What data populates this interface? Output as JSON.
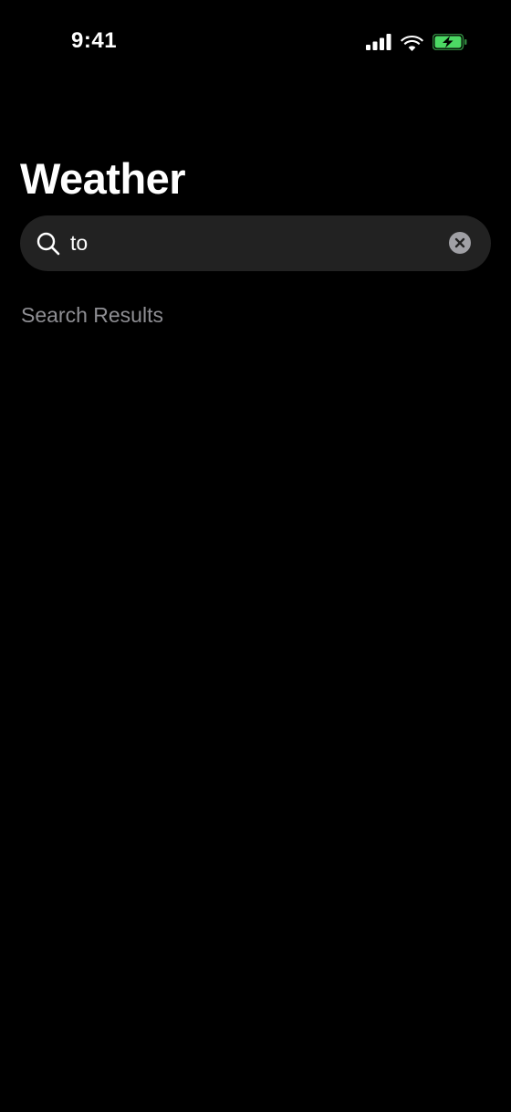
{
  "status_bar": {
    "time": "9:41",
    "icons": [
      "cellular-signal-icon",
      "wifi-icon",
      "battery-charging-icon"
    ],
    "battery_color": "#4cd964"
  },
  "header": {
    "title": "Weather"
  },
  "search": {
    "value": "to",
    "icons": [
      "search-icon",
      "clear-text-icon"
    ]
  },
  "results": {
    "header": "Search Results",
    "items": []
  },
  "colors": {
    "background": "#000000",
    "search_field": "#222222",
    "secondary_text": "#8e8e93",
    "clear_button": "#a0a0a5"
  }
}
